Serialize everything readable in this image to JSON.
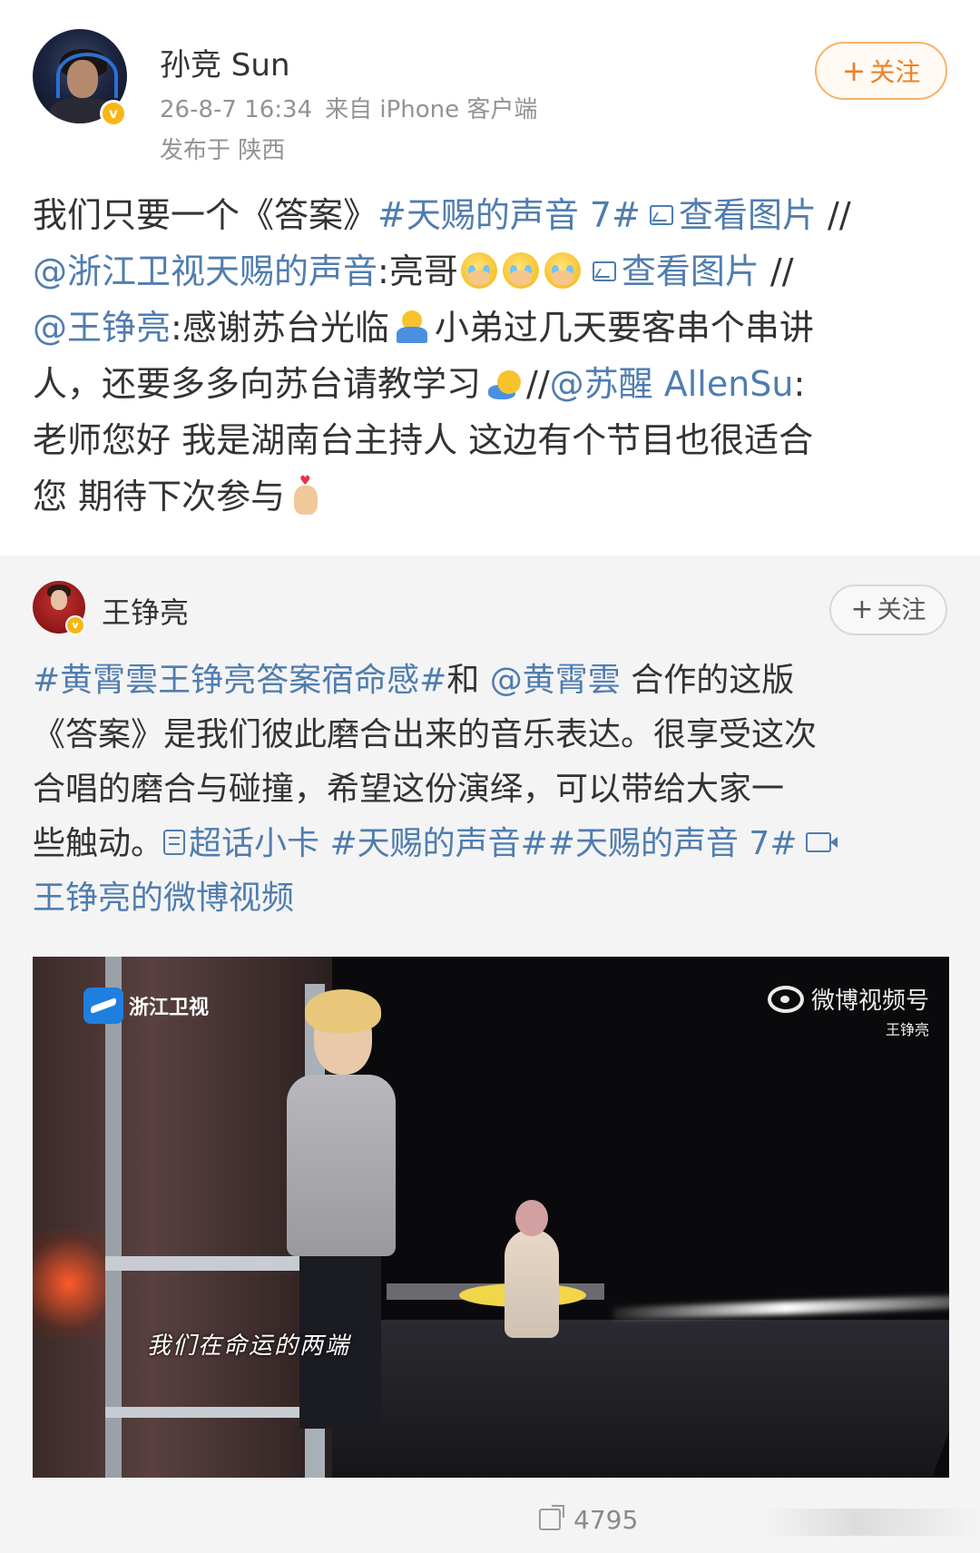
{
  "post": {
    "username": "孙竞 Sun",
    "verified_badge": "v",
    "timestamp": "26-8-7 16:34",
    "source": "来自 iPhone 客户端",
    "location": "发布于 陕西",
    "follow_plus": "+",
    "follow_label": "关注",
    "lines": {
      "l1_text": "我们只要一个《答案》",
      "l1_tag": "#天赐的声音 7#",
      "l1_view": "查看图片",
      "l1_sep": " //",
      "l2_mention": "@浙江卫视天赐的声音",
      "l2_text": ":亮哥",
      "l2_view": "查看图片",
      "l2_sep": " //",
      "l3_mention": "@王铮亮",
      "l3_text_a": ":感谢苏台光临",
      "l3_text_b": "小弟过几天要客串个串讲",
      "l4_text": "人，还要多多向苏台请教学习",
      "l4_sep": "//",
      "l4_mention": "@苏醒 AllenSu",
      "l4_colon": ":",
      "l5_text": "老师您好 我是湖南台主持人 这边有个节目也很适合",
      "l6_text": "您 期待下次参与"
    }
  },
  "repost": {
    "username": "王铮亮",
    "verified_badge": "v",
    "follow_plus": "+",
    "follow_label": "关注",
    "lines": {
      "l1_tag": "#黄霄雲王铮亮答案宿命感#",
      "l1_text": "和 ",
      "l1_mention": "@黄霄雲",
      "l1_text2": " 合作的这版",
      "l2_text": "《答案》是我们彼此磨合出来的音乐表达。很享受这次",
      "l3_text": "合唱的磨合与碰撞，希望这份演绎，可以带给大家一",
      "l4_text": "些触动。",
      "l4_supertopic": "超话小卡",
      "l4_tags": " #天赐的声音##天赐的声音 7#",
      "l5_video": "王铮亮的微博视频"
    },
    "video": {
      "channel_logo": "浙江卫视",
      "watermark": "微博视频号",
      "watermark_sub": "王铮亮",
      "subtitle": "我们在命运的两端"
    },
    "actions": {
      "repost_count": "4795"
    }
  },
  "colors": {
    "link": "#507daf",
    "follow_orange": "#ee8126",
    "meta_gray": "#939393",
    "repost_bg": "#f4f4f4"
  }
}
